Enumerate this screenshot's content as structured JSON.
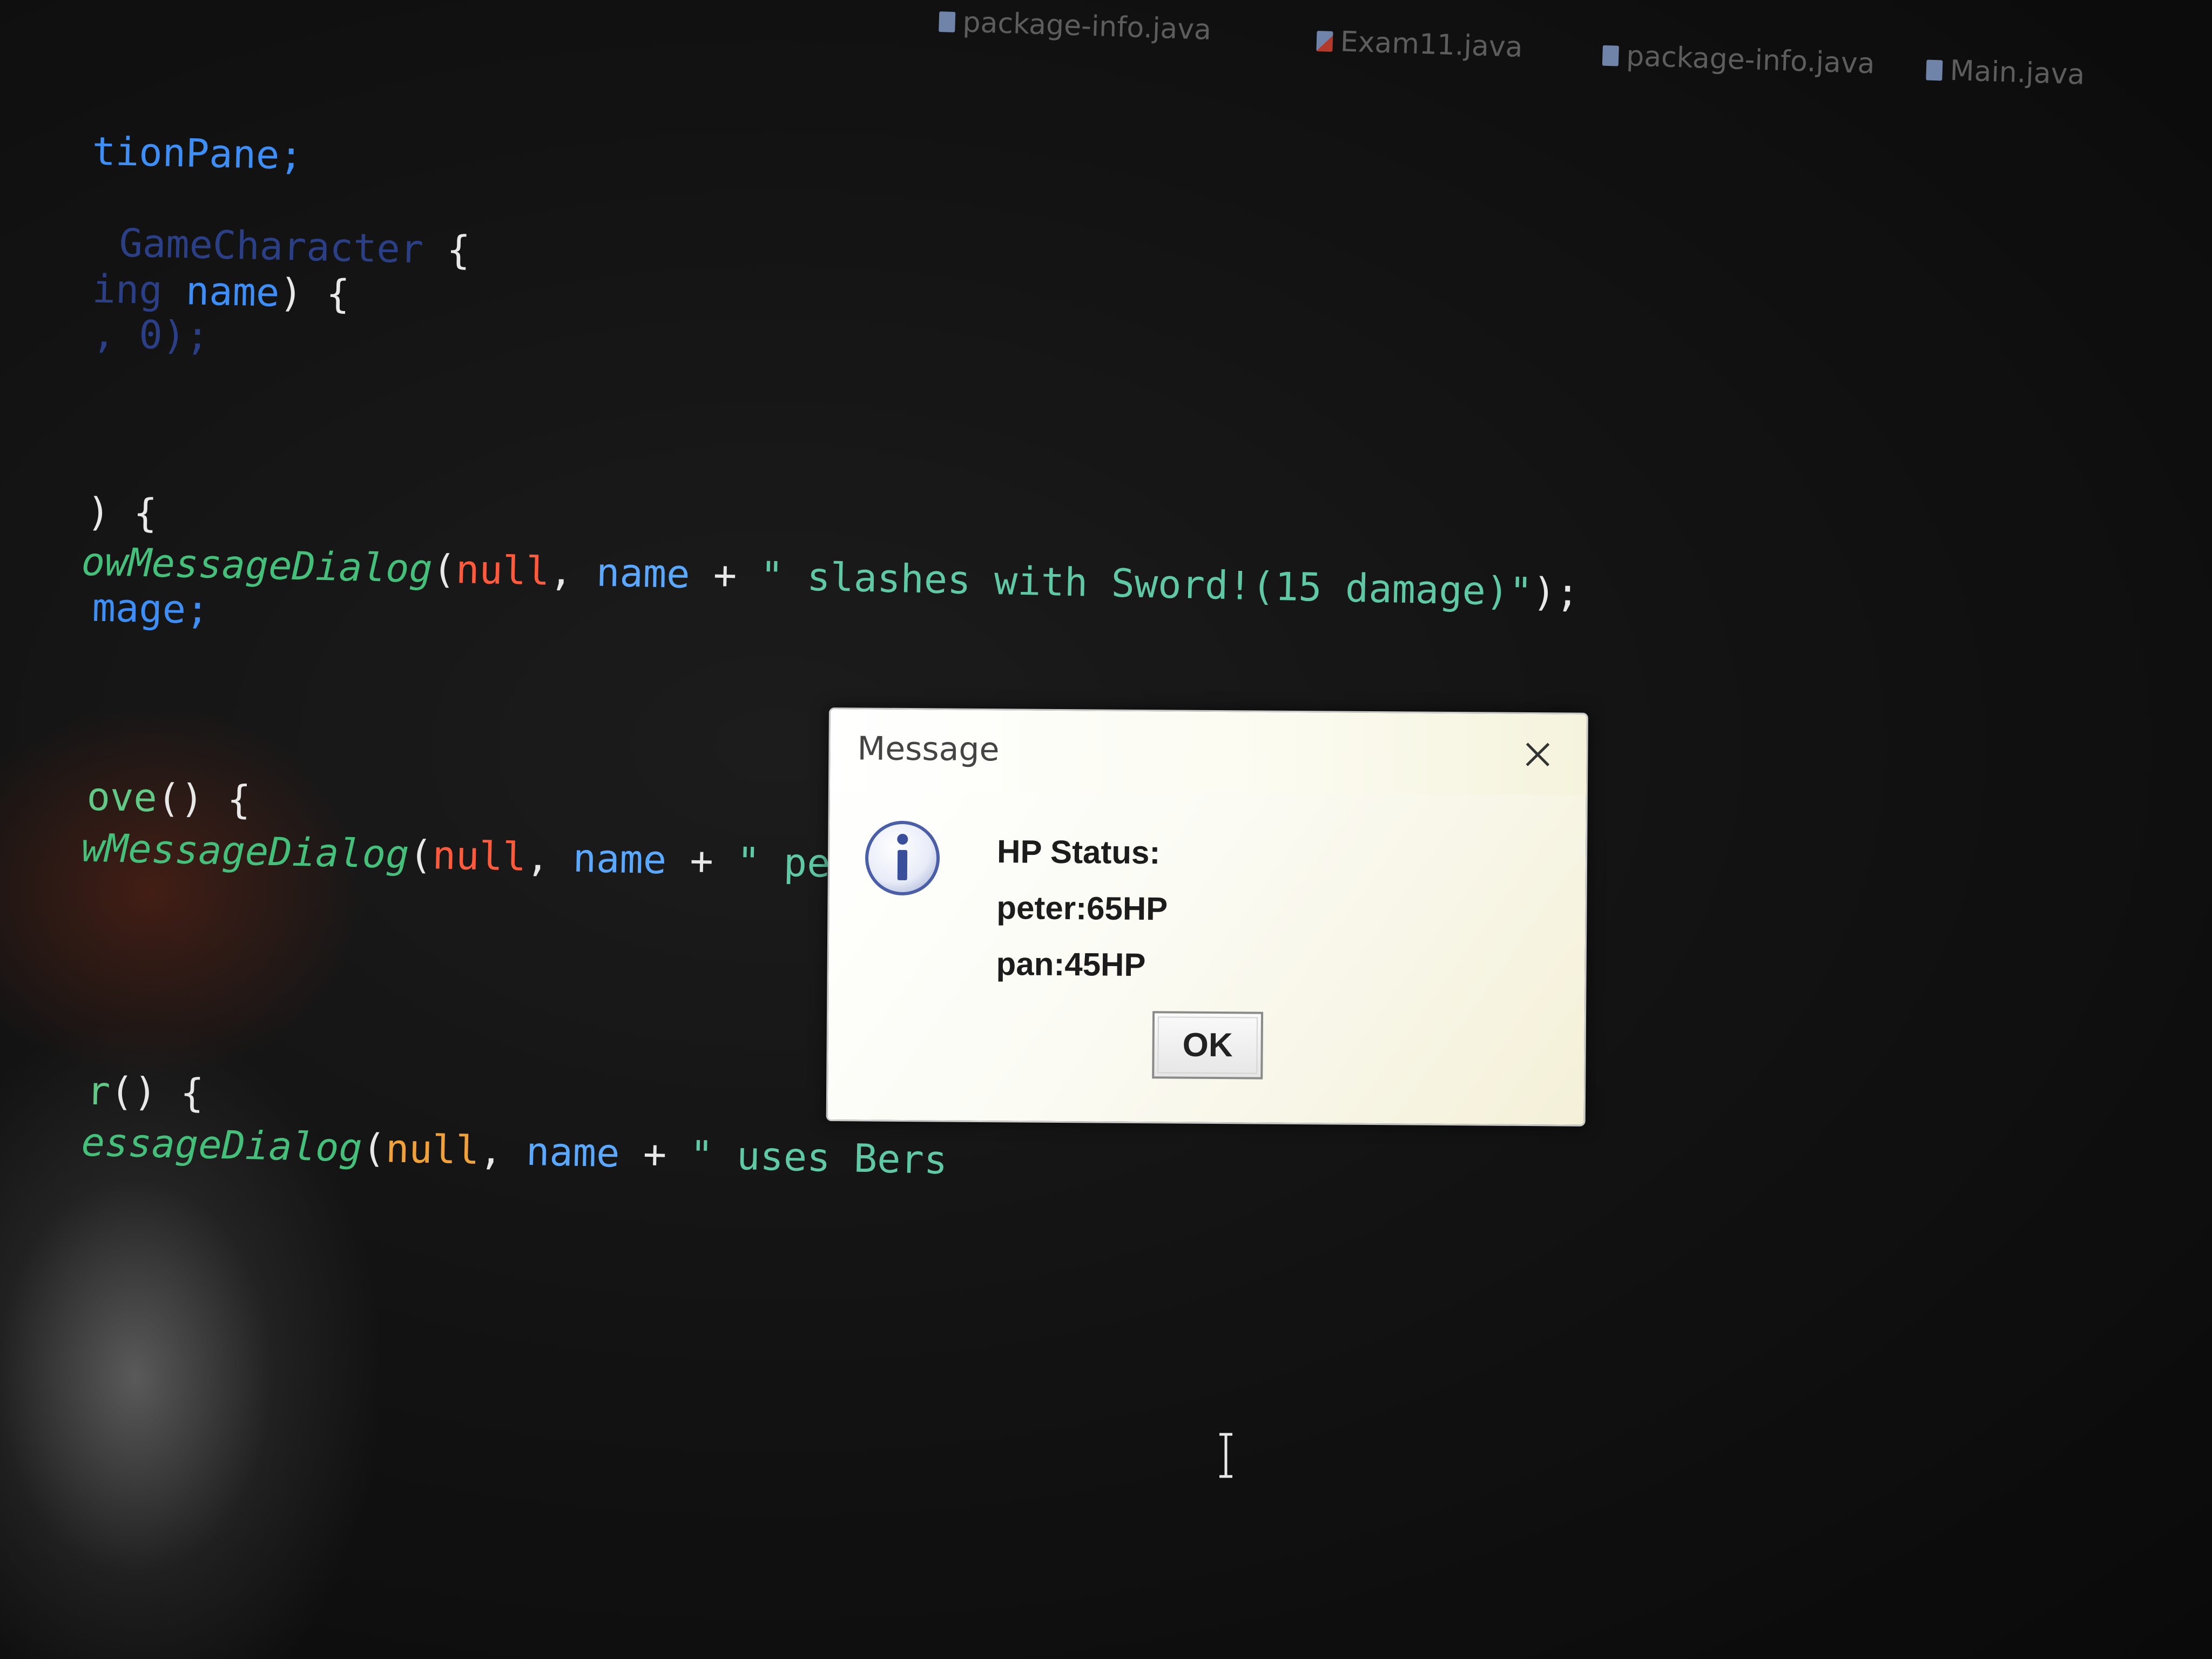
{
  "editor": {
    "tabs": [
      {
        "label": "package-info.java",
        "icon": "java-file-icon"
      },
      {
        "label": "Exam11.java",
        "icon": "java-class-error-icon"
      },
      {
        "label": "package-info.java",
        "icon": "java-file-icon"
      },
      {
        "label": "Main.java",
        "icon": "java-file-icon"
      }
    ],
    "code": {
      "line1": "tionPane;",
      "line2_kw": "GameCharacter",
      "line2_rest": " {",
      "line3_kw": "ing ",
      "line3_name": "name",
      "line3_rest": ") {",
      "line4": ", 0);",
      "line5": ") {",
      "line6_method": "owMessageDialog",
      "line6_open": "(",
      "line6_null": "null",
      "line6_comma": ", ",
      "line6_name": "name",
      "line6_plus": " + ",
      "line6_str": "\" slashes with Sword!(15 damage)\"",
      "line6_end": ");",
      "line7": "mage;",
      "line8_a": "ove",
      "line8_b": "() {",
      "line9_method": "wMessageDialog",
      "line9_open": "(",
      "line9_null": "null",
      "line9_comma": ", ",
      "line9_name": "name",
      "line9_plus": " + ",
      "line9_str": "\" performs",
      "line10_a": "r",
      "line10_b": "() {",
      "line11_method": "essageDialog",
      "line11_open": "(",
      "line11_null": "null",
      "line11_comma": ", ",
      "line11_name": "name",
      "line11_plus": " + ",
      "line11_str": "\" uses Bers"
    }
  },
  "dialog": {
    "title": "Message",
    "icon": "info-icon",
    "lines": [
      "HP Status:",
      "peter:65HP",
      "pan:45HP"
    ],
    "ok_label": "OK"
  },
  "colors": {
    "background": "#131313",
    "keyword_blue": "#3e8ef7",
    "method_green": "#44c07a",
    "null_red": "#ff5a3b",
    "string_teal": "#5fc9a6"
  }
}
